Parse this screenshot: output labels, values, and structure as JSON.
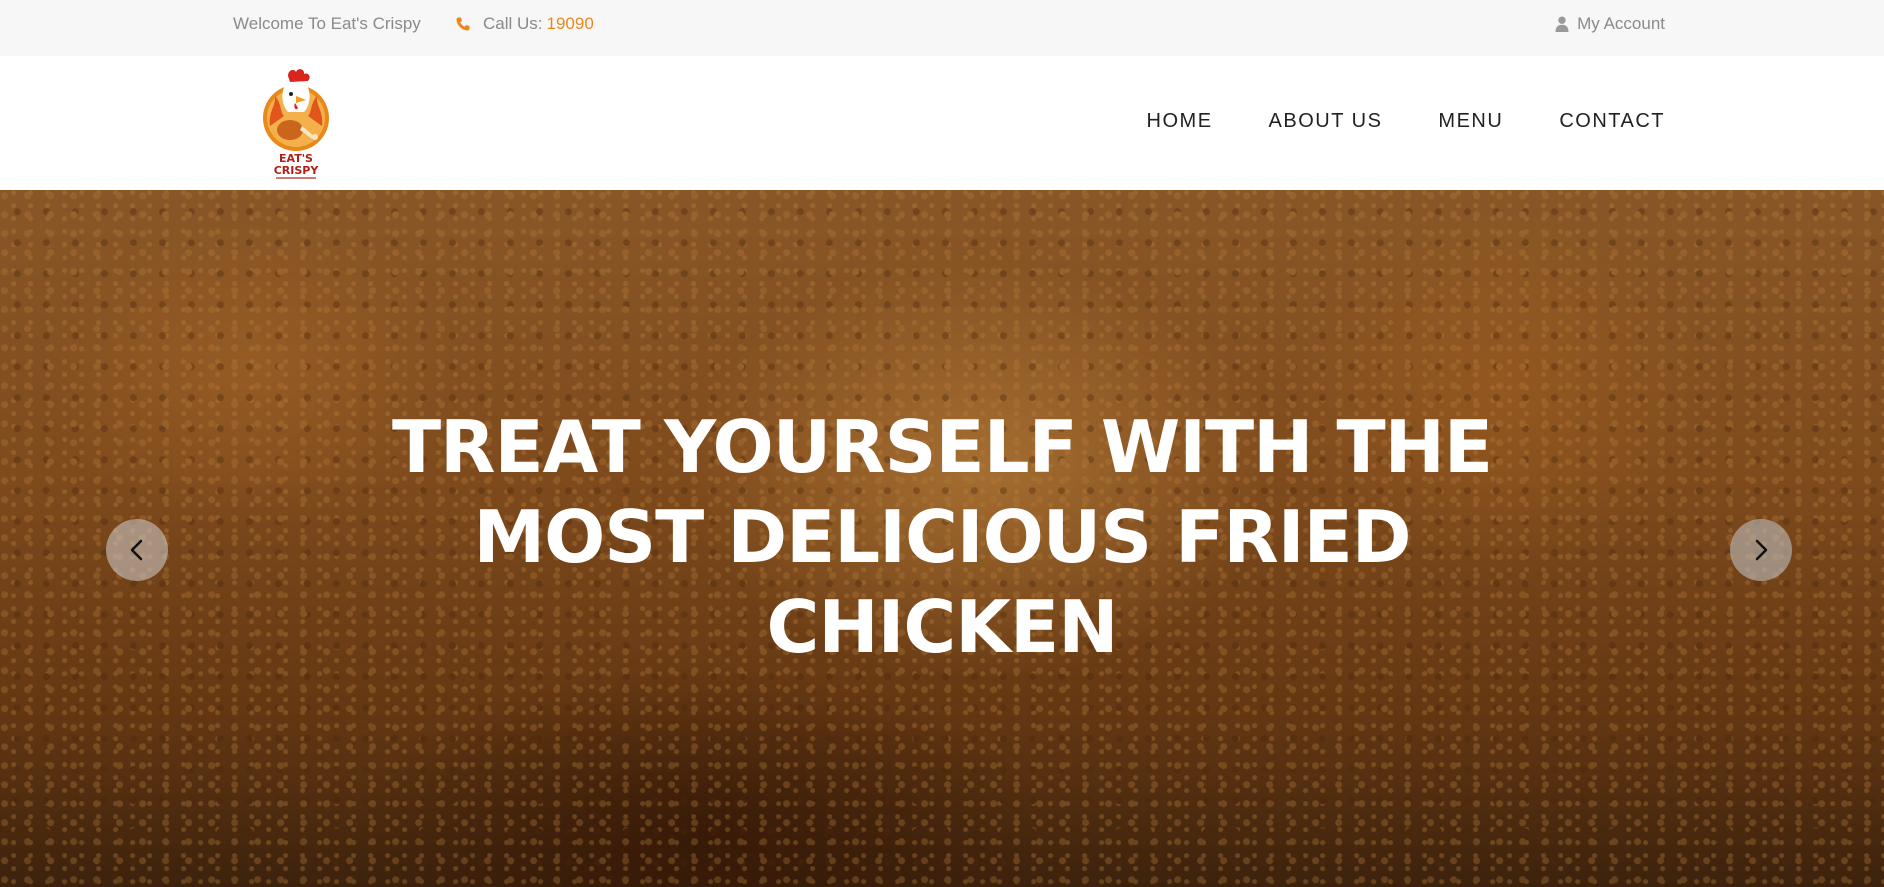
{
  "topbar": {
    "welcome": "Welcome To Eat's Crispy",
    "call_label": "Call Us:",
    "phone": "19090",
    "account": "My Account"
  },
  "logo": {
    "line1": "EAT'S",
    "line2": "CRISPY"
  },
  "nav": {
    "items": [
      {
        "label": "HOME"
      },
      {
        "label": "ABOUT US"
      },
      {
        "label": "MENU"
      },
      {
        "label": "CONTACT"
      }
    ]
  },
  "hero": {
    "title_line1": "TREAT YOURSELF WITH THE",
    "title_line2": "MOST DELICIOUS FRIED",
    "title_line3": "CHICKEN"
  },
  "colors": {
    "accent": "#e8891c",
    "muted_text": "#8a8a8a",
    "topbar_bg": "#f7f7f7"
  },
  "icons": {
    "phone": "phone-icon",
    "account": "user-icon",
    "prev": "chevron-left-icon",
    "next": "chevron-right-icon"
  }
}
